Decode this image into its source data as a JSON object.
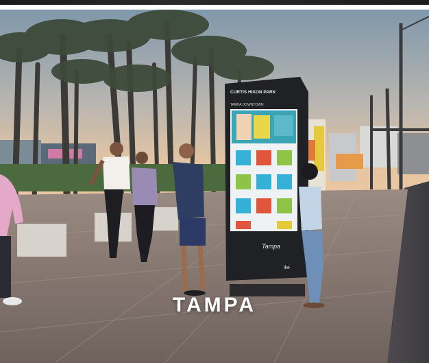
{
  "image": {
    "caption": "TAMPA",
    "kiosk_header": "CURTIS HIXON PARK",
    "kiosk_subheader": "TAMPA DOWNTOWN",
    "kiosk_logo_text": "Tampa",
    "kiosk_brand_text": "ike",
    "colors": {
      "sky_top": "#8aa2b3",
      "sky_glow": "#e9c7a2",
      "pavement": "#8e7f78",
      "kiosk_body": "#1f2124",
      "screen": "#f1f4f6",
      "caption": "#ffffff"
    }
  }
}
